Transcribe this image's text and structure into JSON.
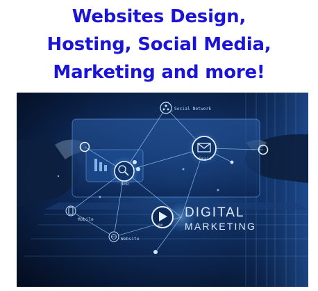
{
  "headline": {
    "line1": "Websites Design,",
    "line2": "Hosting, Social Media,",
    "line3": "Marketing and more!",
    "color": "#1a14d6"
  },
  "banner": {
    "labels": {
      "social_network": "Social Network",
      "email": "Email",
      "seo": "SEO",
      "mobile": "Mobile",
      "website": "Website",
      "vdo": "VDO"
    },
    "title_line1": "DIGITAL",
    "title_line2": "MARKETING",
    "icons": [
      "social-network-icon",
      "email-icon",
      "seo-icon",
      "play-icon",
      "chart-icon",
      "mobile-icon",
      "website-icon"
    ],
    "accent_color": "#4aa3ff"
  }
}
